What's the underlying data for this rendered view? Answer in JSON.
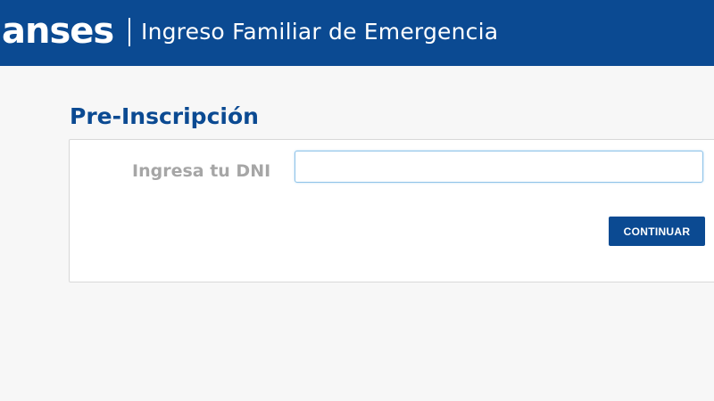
{
  "header": {
    "brand": "anses",
    "title": "Ingreso Familiar de Emergencia",
    "background_color": "#0b4a92"
  },
  "main": {
    "page_title": "Pre-Inscripción",
    "form": {
      "dni_label": "Ingresa tu DNI",
      "dni_value": "",
      "dni_placeholder": "",
      "continue_label": "CONTINUAR"
    }
  },
  "colors": {
    "accent": "#0b4a92",
    "background": "#f7f7f7",
    "label": "#a6a6a6",
    "input_focus_border": "#8fc3e8"
  }
}
